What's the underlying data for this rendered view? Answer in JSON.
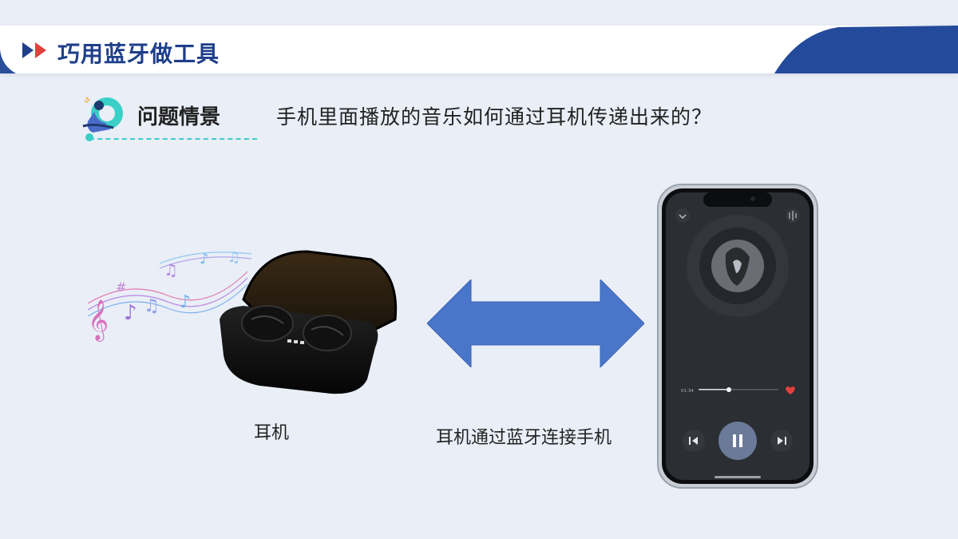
{
  "header": {
    "title": "巧用蓝牙做工具"
  },
  "question": {
    "label": "问题情景",
    "text": "手机里面播放的音乐如何通过耳机传递出来的？"
  },
  "illustration": {
    "earbuds_label": "耳机",
    "connection_label": "耳机通过蓝牙连接手机"
  },
  "player": {
    "time": "01:34",
    "progress": 0.38
  },
  "colors": {
    "brand_blue": "#1f3f8a",
    "arrow_blue": "#4a76c9",
    "teal": "#3ad0c8",
    "red": "#e0413c"
  }
}
